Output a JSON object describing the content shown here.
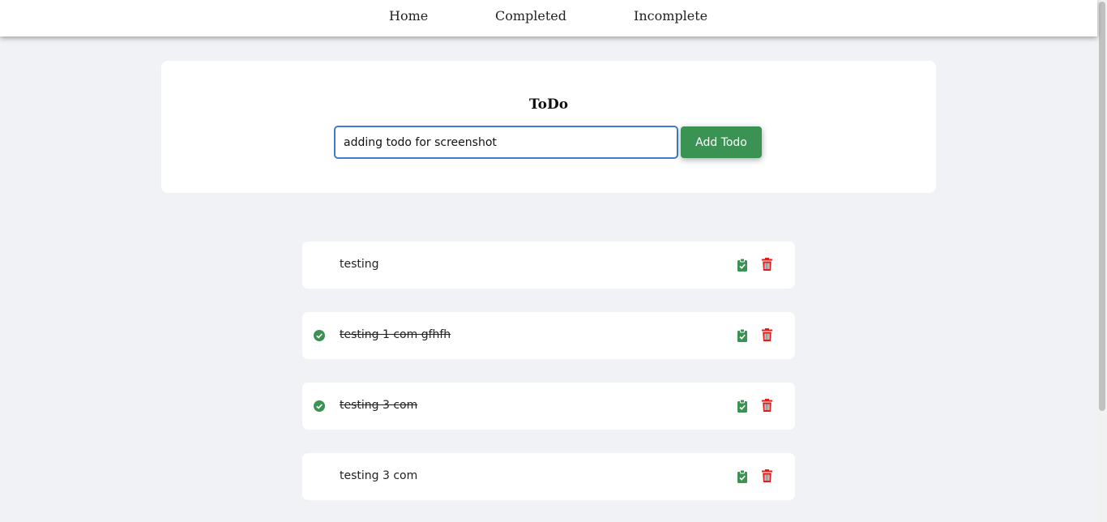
{
  "nav": {
    "links": [
      {
        "label": "Home"
      },
      {
        "label": "Completed"
      },
      {
        "label": "Incomplete"
      }
    ]
  },
  "form": {
    "title": "ToDo",
    "input_value": "adding todo for screenshot",
    "add_label": "Add Todo"
  },
  "todos": [
    {
      "text": "testing",
      "completed": false
    },
    {
      "text": "testing 1 com gfhfh",
      "completed": true
    },
    {
      "text": "testing 3 com",
      "completed": true
    },
    {
      "text": "testing 3 com",
      "completed": false
    }
  ],
  "icons": {
    "completed_marker": "check-circle-icon",
    "mark_complete": "clipboard-check-icon",
    "delete": "trash-icon"
  },
  "colors": {
    "accent_green": "#3a9253",
    "delete_red": "#e01e1e",
    "input_border": "#3f7bd1",
    "page_bg": "#f1f2f5"
  }
}
